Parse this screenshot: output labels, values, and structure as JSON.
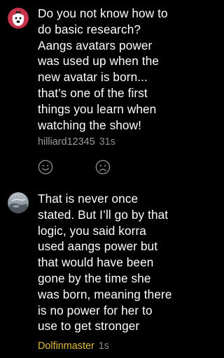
{
  "comments": [
    {
      "avatar": "cartoon-dog-avatar",
      "lines": [
        "Do you not know how to",
        "do basic research?",
        "Aangs avatars power",
        "was used up when the",
        "new avatar is born...",
        "that’s one of the first",
        "things you learn when",
        "watching the show!"
      ],
      "username": "hilliard12345",
      "time": "31s",
      "reactions": [
        "smiley-face-icon",
        "frowning-face-icon"
      ]
    },
    {
      "avatar": "photo-avatar",
      "lines": [
        "That is never once",
        "stated. But I’ll go by that",
        "logic, you said korra",
        "used aangs power but",
        "that would have been",
        "gone by the time she",
        "was born, meaning there",
        "is no power for her to",
        "use to get stronger"
      ],
      "username": "Dolfinmaster",
      "time": "1s"
    }
  ],
  "colors": {
    "background": "#000000",
    "text": "#ffffff",
    "username": "#9a9a9a",
    "highlight_username": "#e0b93b",
    "avatar_red": "#c8344a"
  }
}
